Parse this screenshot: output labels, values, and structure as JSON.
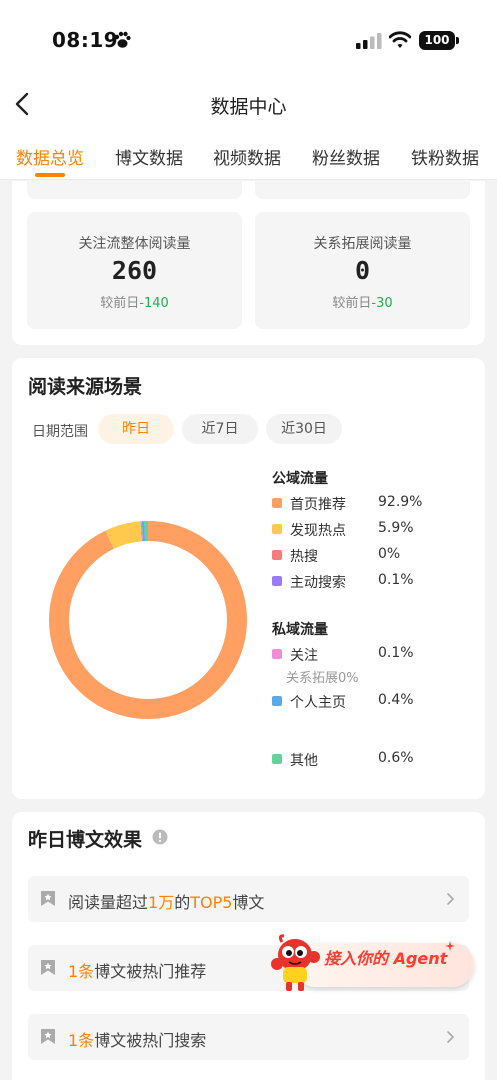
{
  "status_bar": {
    "time": "08:19",
    "battery": "100"
  },
  "header": {
    "title": "数据中心"
  },
  "tabs": [
    {
      "label": "数据总览",
      "active": true
    },
    {
      "label": "博文数据"
    },
    {
      "label": "视频数据"
    },
    {
      "label": "粉丝数据"
    },
    {
      "label": "铁粉数据"
    }
  ],
  "stats": [
    {
      "label": "关注流整体阅读量",
      "value": "260",
      "delta_prefix": "较前日",
      "delta": "-140"
    },
    {
      "label": "关系拓展阅读量",
      "value": "0",
      "delta_prefix": "较前日",
      "delta": "-30"
    }
  ],
  "reading_source": {
    "title": "阅读来源场景",
    "range_label": "日期范围",
    "ranges": [
      {
        "label": "昨日",
        "active": true
      },
      {
        "label": "近7日"
      },
      {
        "label": "近30日"
      }
    ],
    "public_title": "公域流量",
    "public": [
      {
        "name": "首页推荐",
        "value": "92.9%",
        "color": "#ff9f62"
      },
      {
        "name": "发现热点",
        "value": "5.9%",
        "color": "#ffc94d"
      },
      {
        "name": "热搜",
        "value": "0%",
        "color": "#f47c7c"
      },
      {
        "name": "主动搜索",
        "value": "0.1%",
        "color": "#9b7bf5"
      }
    ],
    "private_title": "私域流量",
    "private": [
      {
        "name": "关注",
        "value": "0.1%",
        "color": "#f08cd8"
      },
      {
        "name": "个人主页",
        "value": "0.4%",
        "color": "#5ba9e6"
      }
    ],
    "private_sub": "关系拓展0%",
    "other": {
      "name": "其他",
      "value": "0.6%",
      "color": "#5fd39a"
    }
  },
  "chart_data": {
    "type": "pie",
    "categories": [
      "首页推荐",
      "发现热点",
      "热搜",
      "主动搜索",
      "关注",
      "关系拓展",
      "个人主页",
      "其他"
    ],
    "values": [
      92.9,
      5.9,
      0,
      0.1,
      0.1,
      0,
      0.4,
      0.6
    ],
    "colors": [
      "#ff9f62",
      "#ffc94d",
      "#f47c7c",
      "#9b7bf5",
      "#f08cd8",
      "#f08cd8",
      "#5ba9e6",
      "#5fd39a"
    ],
    "donut": true
  },
  "yesterday_effect": {
    "title": "昨日博文效果",
    "rows": [
      {
        "parts": [
          "阅读量超过",
          "1万",
          "的",
          "TOP5",
          "博文"
        ]
      },
      {
        "parts": [
          "1条",
          "博文被热门推荐"
        ]
      },
      {
        "parts": [
          "1条",
          "博文被热门搜索"
        ]
      }
    ]
  },
  "agent": {
    "label": "接入你的 Agent"
  }
}
